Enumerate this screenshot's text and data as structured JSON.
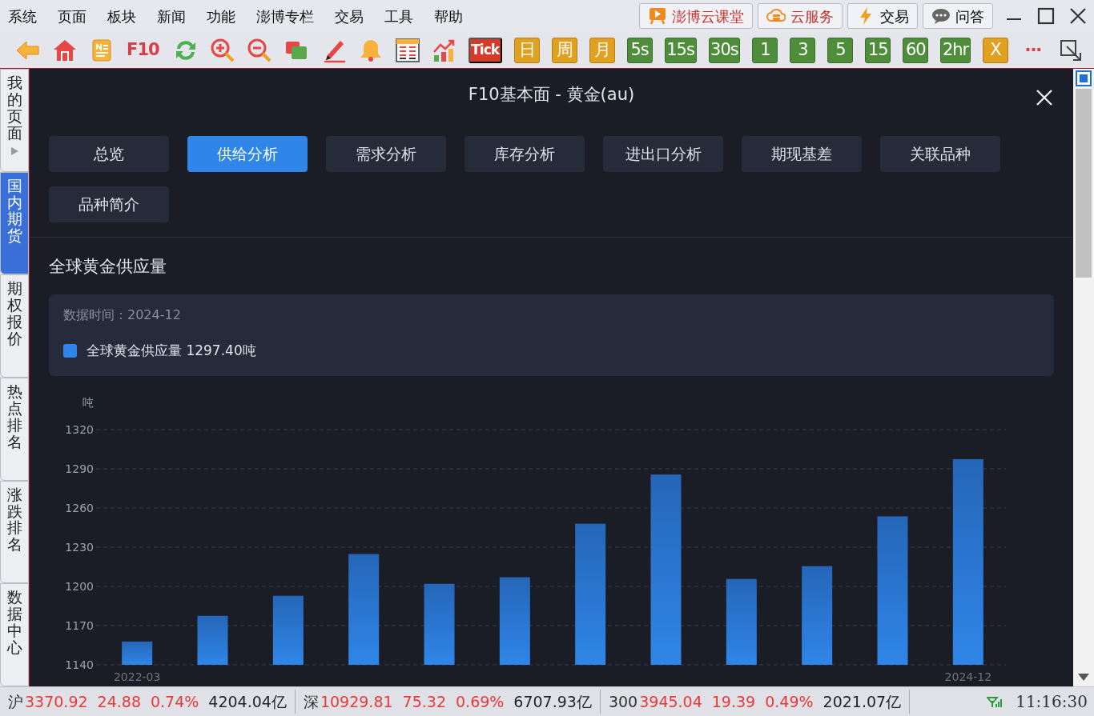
{
  "menu": [
    "系统",
    "页面",
    "板块",
    "新闻",
    "功能",
    "澎博专栏",
    "交易",
    "工具",
    "帮助"
  ],
  "header_buttons": [
    {
      "label": "澎博云课堂",
      "kind": "course"
    },
    {
      "label": "云服务",
      "kind": "cloud"
    },
    {
      "label": "交易",
      "kind": "trade"
    },
    {
      "label": "问答",
      "kind": "qa"
    }
  ],
  "toolbar": [
    {
      "label": "F10",
      "kind": "plain"
    },
    {
      "label": "Tick",
      "kind": "red"
    },
    {
      "label": "日",
      "kind": "gold"
    },
    {
      "label": "周",
      "kind": "gold"
    },
    {
      "label": "月",
      "kind": "gold"
    },
    {
      "label": "5s",
      "kind": "green"
    },
    {
      "label": "15s",
      "kind": "green"
    },
    {
      "label": "30s",
      "kind": "green"
    },
    {
      "label": "1",
      "kind": "green"
    },
    {
      "label": "3",
      "kind": "green"
    },
    {
      "label": "5",
      "kind": "green"
    },
    {
      "label": "15",
      "kind": "green"
    },
    {
      "label": "60",
      "kind": "green"
    },
    {
      "label": "2hr",
      "kind": "green"
    },
    {
      "label": "X",
      "kind": "gold"
    },
    {
      "label": "···",
      "kind": "plain"
    }
  ],
  "sidebar": {
    "items": [
      {
        "label": "我的页面",
        "selected": false
      },
      {
        "label": "国内期货",
        "selected": true
      },
      {
        "label": "期权报价",
        "selected": false
      },
      {
        "label": "热点排名",
        "selected": false
      },
      {
        "label": "涨跌排名",
        "selected": false
      },
      {
        "label": "数据中心",
        "selected": false
      }
    ]
  },
  "panel": {
    "title": "F10基本面 - 黄金(au)",
    "tabs": [
      {
        "label": "总览",
        "selected": false
      },
      {
        "label": "供给分析",
        "selected": true
      },
      {
        "label": "需求分析",
        "selected": false
      },
      {
        "label": "库存分析",
        "selected": false
      },
      {
        "label": "进出口分析",
        "selected": false
      },
      {
        "label": "期现基差",
        "selected": false
      },
      {
        "label": "关联品种",
        "selected": false
      },
      {
        "label": "品种简介",
        "selected": false
      }
    ],
    "section_title": "全球黄金供应量",
    "info": {
      "data_time": "数据时间：2024-12",
      "legend_value": "1297.40吨"
    },
    "chart_data": {
      "type": "bar",
      "ylabel": "吨",
      "ylim": [
        1140,
        1320
      ],
      "yticks": [
        1140,
        1170,
        1200,
        1230,
        1260,
        1290,
        1320
      ],
      "grid": true,
      "categories": [
        "2022-03",
        null,
        null,
        null,
        null,
        null,
        null,
        null,
        null,
        null,
        null,
        "2024-12"
      ],
      "series": [
        {
          "name": "全球黄金供应量",
          "color": "#2f86e8",
          "values": [
            1157.8,
            1177.5,
            1192.8,
            1224.8,
            1202,
            1207,
            1248,
            1285.6,
            1205.7,
            1215.5,
            1253.6,
            1297.4
          ]
        }
      ]
    }
  },
  "status_bar": [
    {
      "market": "沪",
      "price": "3370.92",
      "change": "24.88",
      "percent": "0.74%",
      "amount": "4204.04亿"
    },
    {
      "market": "深",
      "price": "10929.81",
      "change": "75.32",
      "percent": "0.69%",
      "amount": "6707.93亿"
    },
    {
      "market": "300",
      "price": "3945.04",
      "change": "19.39",
      "percent": "0.49%",
      "amount": "2021.07亿"
    }
  ],
  "time": "11:16:30"
}
